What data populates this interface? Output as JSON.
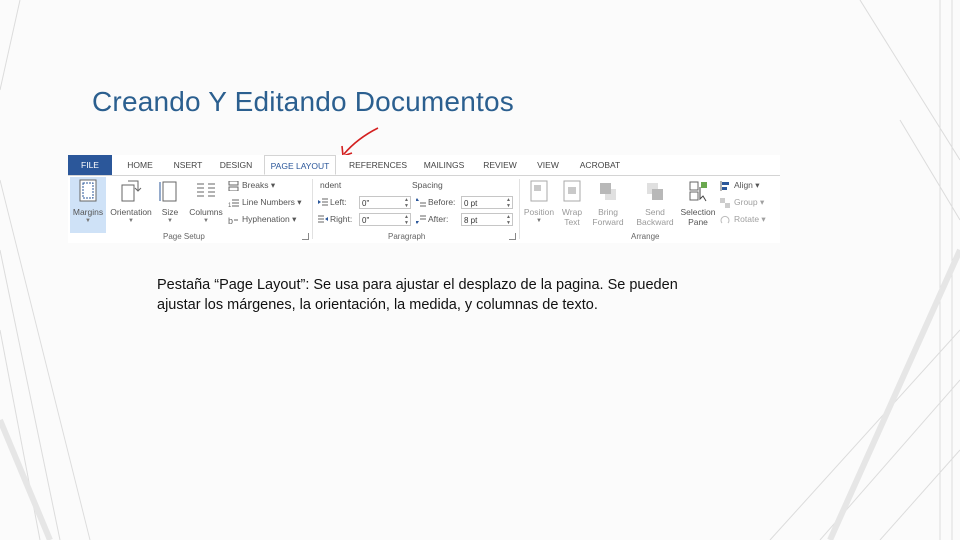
{
  "slide": {
    "title": "Creando Y Editando Documentos",
    "body": "Pestaña “Page Layout”: Se usa para ajustar el desplazo de la pagina. Se pueden ajustar los márgenes, la orientación, la medida, y columnas de texto."
  },
  "ribbon": {
    "tabs": {
      "file": "FILE",
      "home": "HOME",
      "insert": "NSERT",
      "design": "DESIGN",
      "page_layout": "PAGE LAYOUT",
      "references": "REFERENCES",
      "mailings": "MAILINGS",
      "review": "REVIEW",
      "view": "VIEW",
      "acrobat": "ACROBAT"
    },
    "active_tab": "PAGE LAYOUT",
    "page_setup": {
      "label": "Page Setup",
      "margins": "Margins",
      "orientation": "Orientation",
      "size": "Size",
      "columns": "Columns",
      "breaks": "Breaks",
      "line_numbers": "Line Numbers",
      "hyphenation": "Hyphenation"
    },
    "paragraph": {
      "label": "Paragraph",
      "indent": "ndent",
      "left_label": "Left:",
      "left_value": "0\"",
      "right_label": "Right:",
      "right_value": "0\"",
      "spacing": "Spacing",
      "before_label": "Before:",
      "before_value": "0 pt",
      "after_label": "After:",
      "after_value": "8 pt"
    },
    "arrange": {
      "label": "Arrange",
      "position": "Position",
      "wrap_text_1": "Wrap",
      "wrap_text_2": "Text",
      "bring_forward_1": "Bring",
      "bring_forward_2": "Forward",
      "send_backward_1": "Send",
      "send_backward_2": "Backward",
      "selection_pane_1": "Selection",
      "selection_pane_2": "Pane",
      "align": "Align",
      "group": "Group",
      "rotate": "Rotate"
    },
    "colors": {
      "file_tab": "#2b579a",
      "active_tab_text": "#2b579a",
      "selected_button": "#cfe2f7"
    }
  },
  "annotation": {
    "arrow_color": "#d42020"
  }
}
